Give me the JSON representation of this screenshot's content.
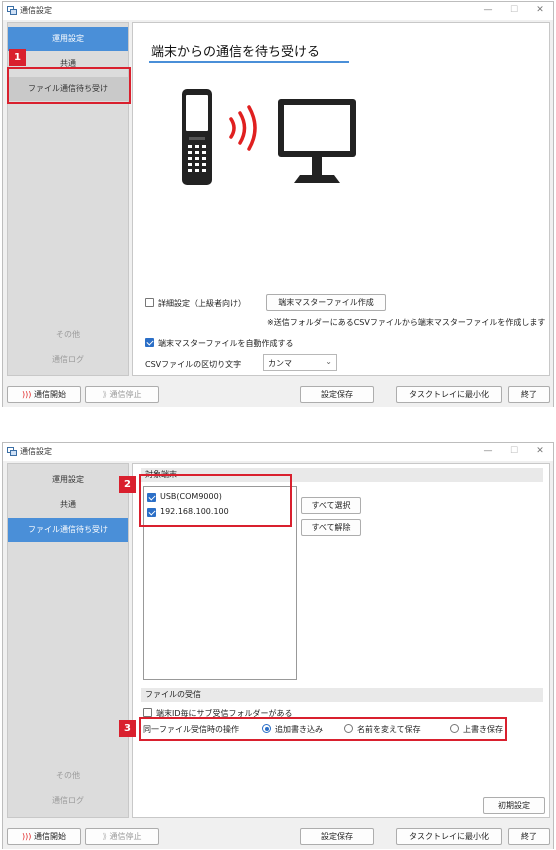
{
  "window": {
    "title": "通信設定",
    "min": "—",
    "max": "☐",
    "close": "✕"
  },
  "sidebar": {
    "items": [
      {
        "label": "運用設定"
      },
      {
        "label": "共通"
      },
      {
        "label": "ファイル通信待ち受け"
      },
      {
        "label": "その他"
      },
      {
        "label": "通信ログ"
      }
    ]
  },
  "footer": {
    "start": "通信開始",
    "stop": "通信停止",
    "save": "設定保存",
    "tray": "タスクトレイに最小化",
    "exit": "終了"
  },
  "screen1": {
    "heading": "端末からの通信を待ち受ける",
    "advanced": {
      "label": "詳細設定（上級者向け）",
      "checked": false
    },
    "master_btn": "端末マスターファイル作成",
    "note": "※送信フォルダーにあるCSVファイルから端末マスターファイルを作成します",
    "auto": {
      "label": "端末マスターファイルを自動作成する",
      "checked": true
    },
    "csv_label": "CSVファイルの区切り文字",
    "csv_value": "カンマ",
    "badge": "1"
  },
  "screen2": {
    "target_title": "対象端末",
    "targets": [
      {
        "label": "USB(COM9000)",
        "checked": true
      },
      {
        "label": "192.168.100.100",
        "checked": true
      }
    ],
    "select_all": "すべて選択",
    "deselect_all": "すべて解除",
    "receive_title": "ファイルの受信",
    "subfolder": {
      "label": "端末ID毎にサブ受信フォルダーがある",
      "checked": false
    },
    "same_file_label": "同一ファイル受信時の操作",
    "options": [
      {
        "label": "追加書き込み",
        "selected": true
      },
      {
        "label": "名前を変えて保存",
        "selected": false
      },
      {
        "label": "上書き保存",
        "selected": false
      }
    ],
    "reset": "初期設定",
    "badge2": "2",
    "badge3": "3"
  },
  "colors": {
    "accent": "#4a8fd8",
    "highlight": "#d9202e",
    "signal": "#e02020"
  }
}
